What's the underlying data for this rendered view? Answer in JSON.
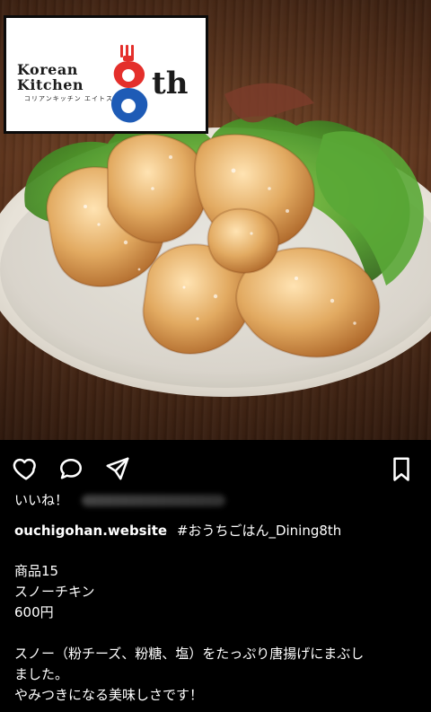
{
  "post": {
    "logo": {
      "line1": "Korean",
      "line2": "Kitchen",
      "subtitle": "コリアンキッチン エイトス",
      "mark": "8",
      "suffix": "th"
    },
    "likes_prefix": "いいね！",
    "username": "ouchigohan.website",
    "hashtag": "#おうちごはん_Dining8th",
    "caption": {
      "line1": "商品15",
      "line2": "スノーチキン",
      "line3": "600円",
      "line4": "スノー（粉チーズ、粉糖、塩）をたっぷり唐揚げにまぶし",
      "line5": "ました。",
      "line6": "やみつきになる美味しさです！"
    },
    "icons": {
      "like": "heart-icon",
      "comment": "comment-icon",
      "share": "paper-plane-icon",
      "save": "bookmark-icon"
    },
    "colors": {
      "background": "#000000",
      "text": "#ffffff",
      "logo_red": "#e42f2b",
      "logo_blue": "#1e5bb6"
    }
  }
}
